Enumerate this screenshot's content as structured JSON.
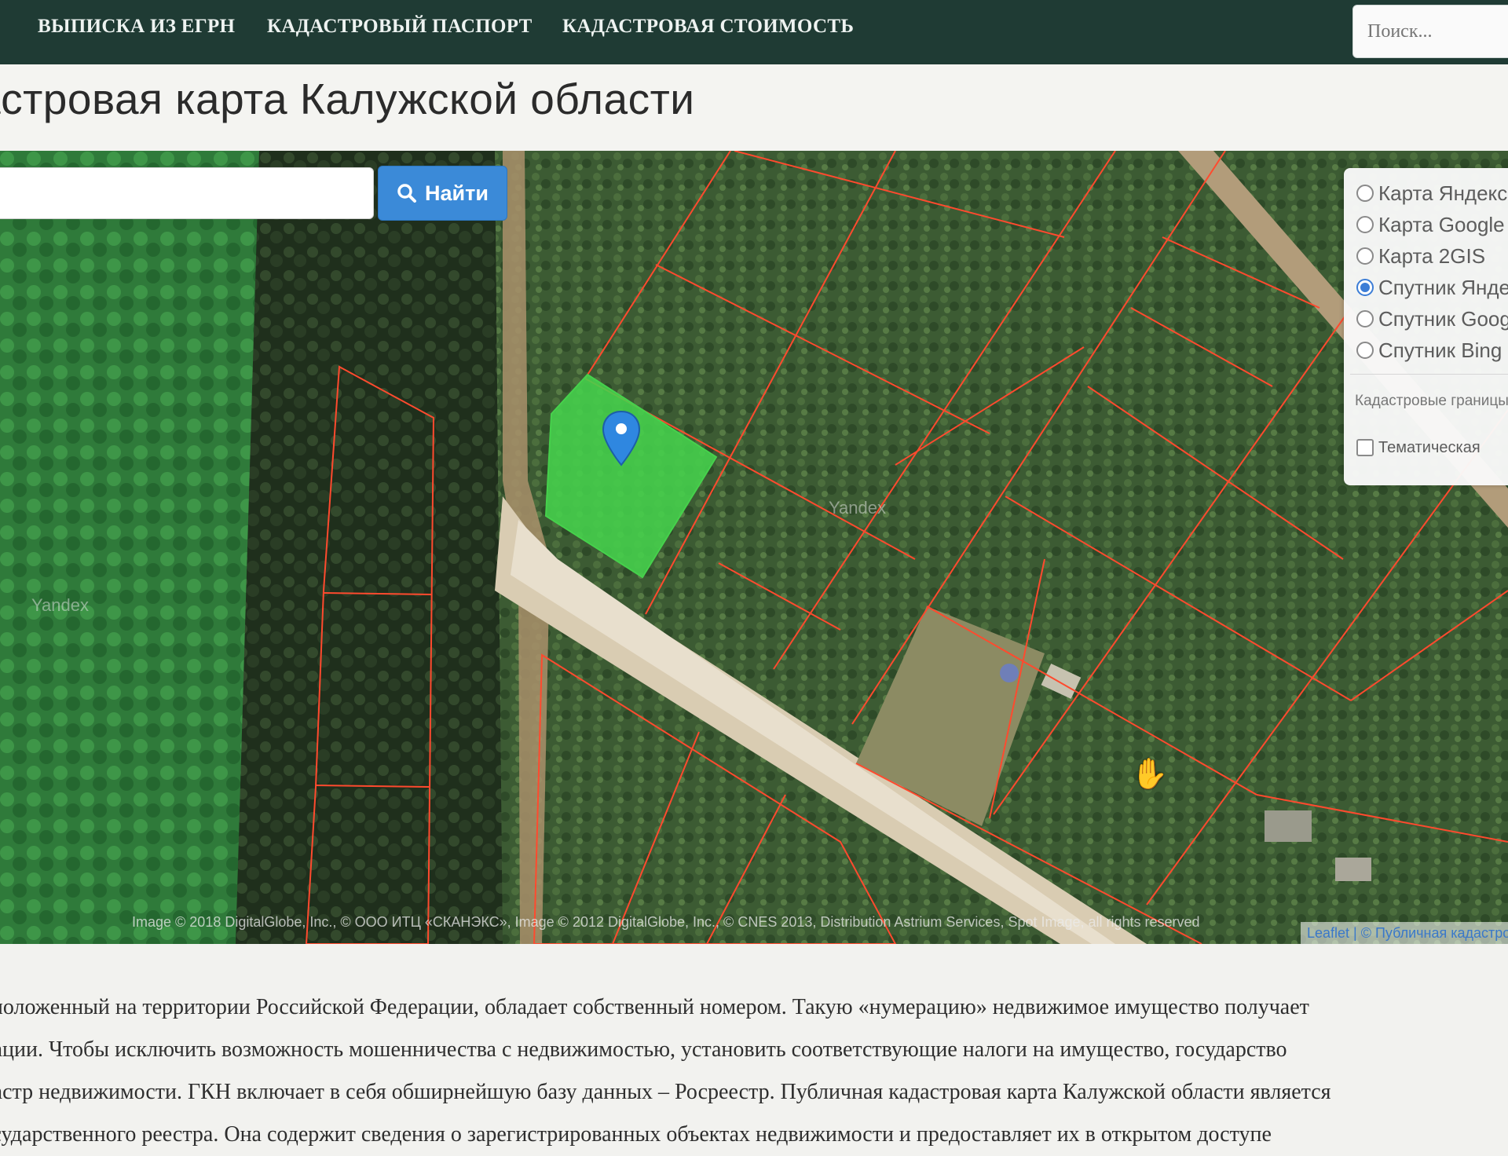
{
  "nav": {
    "links": [
      "ВЫПИСКА ИЗ ЕГРН",
      "КАДАСТРОВЫЙ ПАСПОРТ",
      "КАДАСТРОВАЯ СТОИМОСТЬ"
    ],
    "search_placeholder": "Поиск..."
  },
  "page": {
    "title": "астровая карта Калужской области"
  },
  "map": {
    "search": {
      "value": "",
      "button_label": "Найти",
      "button_icon": "search-icon"
    },
    "layers": {
      "options": [
        "Карта Яндекс",
        "Карта Google",
        "Карта 2GIS",
        "Спутник Яндекс",
        "Спутник Google",
        "Спутник Bing"
      ],
      "selected": "Спутник Яндекс",
      "group_label": "Кадастровые границы",
      "thematic_label": "Тематическая",
      "thematic_checked": false
    },
    "watermark": "Yandex",
    "attribution": "Image © 2018 DigitalGlobe, Inc., © ООО ИТЦ «СКАНЭКС», Image © 2012 DigitalGlobe, Inc., © CNES 2013, Distribution Astrium Services, Spot Image, all rights reserved",
    "leaflet_attribution": "Leaflet | © Публичная кадастровая карта",
    "selected_parcel_color": "#46d14c",
    "boundary_color": "#ff4a2e",
    "marker_color": "#2f87e0"
  },
  "content": {
    "lines": [
      "асположенный на территории Российской Федерации, обладает собственный номером. Такую «нумерацию» недвижимое имущество получает",
      "трации. Чтобы исключить возможность мошенничества с недвижимостью, установить соответствующие налоги на имущество, государство",
      "адастр недвижимости. ГКН включает в себя обширнейшую базу данных – Росреестр. Публичная кадастровая карта Калужской области является",
      "государственного реестра. Она содержит сведения о зарегистрированных объектах недвижимости и предоставляет их в открытом доступе"
    ]
  }
}
